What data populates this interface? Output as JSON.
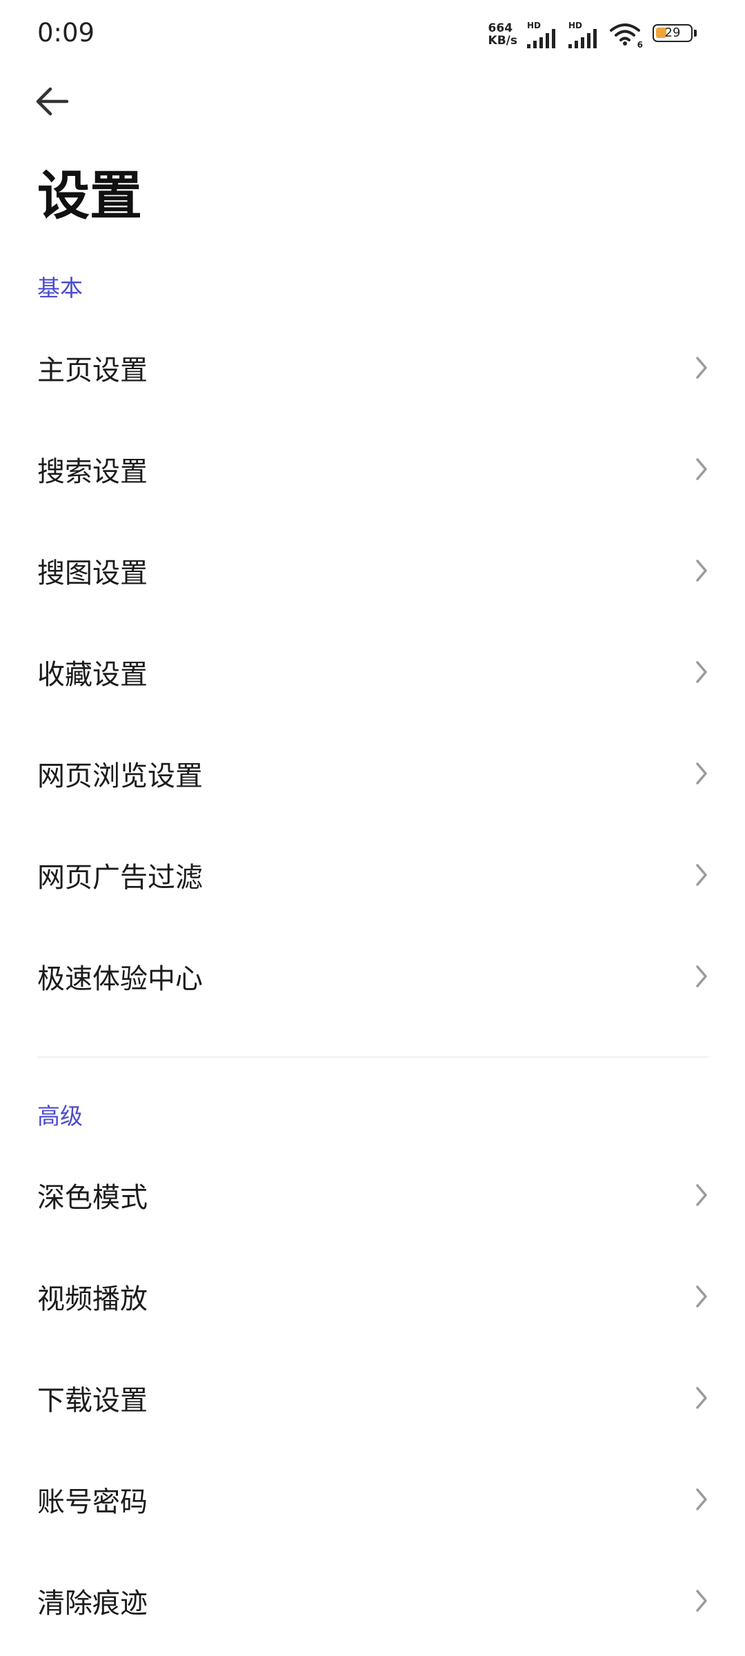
{
  "status_bar": {
    "time": "0:09",
    "net_speed_value": "664",
    "net_speed_unit": "KB/s",
    "sim1_label": "HD",
    "sim2_label": "HD",
    "wifi_label": "6",
    "battery_level": "29",
    "battery_color": "#f0a43a"
  },
  "header": {
    "back_icon": "arrow-left-icon",
    "title": "设置"
  },
  "sections": {
    "basic": {
      "label": "基本",
      "items": [
        {
          "label": "主页设置"
        },
        {
          "label": "搜索设置"
        },
        {
          "label": "搜图设置"
        },
        {
          "label": "收藏设置"
        },
        {
          "label": "网页浏览设置"
        },
        {
          "label": "网页广告过滤"
        },
        {
          "label": "极速体验中心"
        }
      ]
    },
    "advanced": {
      "label": "高级",
      "items": [
        {
          "label": "深色模式"
        },
        {
          "label": "视频播放"
        },
        {
          "label": "下载设置"
        },
        {
          "label": "账号密码"
        },
        {
          "label": "清除痕迹"
        }
      ]
    }
  },
  "colors": {
    "accent": "#4b4ccf",
    "text": "#1c1c1e",
    "chevron": "#9a9aa0"
  }
}
